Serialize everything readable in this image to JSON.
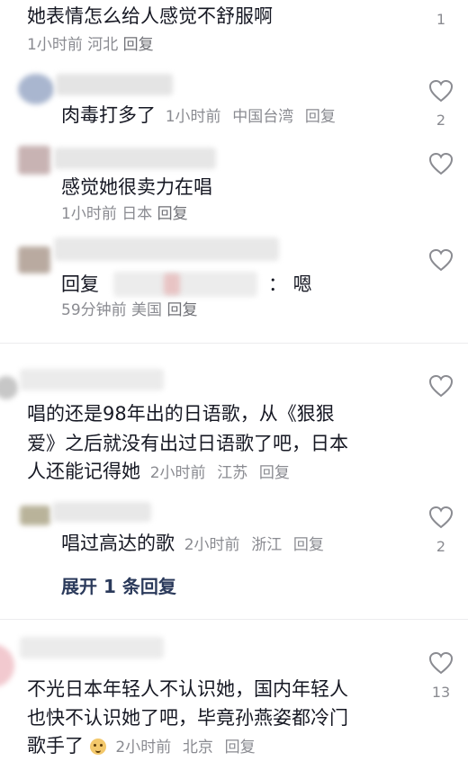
{
  "comments": [
    {
      "text": "她表情怎么给人感觉不舒服啊",
      "time": "1小时前",
      "location": "河北",
      "reply": "回复",
      "likes": "1"
    },
    {
      "text": "肉毒打多了",
      "time": "1小时前",
      "location": "中国台湾",
      "reply": "回复",
      "likes": "2"
    },
    {
      "text": "感觉她很卖力在唱",
      "time": "1小时前",
      "location": "日本",
      "reply": "回复",
      "likes": ""
    },
    {
      "reply_prefix": "回复",
      "text_suffix": "：  嗯",
      "time": "59分钟前",
      "location": "美国",
      "reply": "回复",
      "likes": ""
    },
    {
      "line1": "唱的还是98年出的日语歌，从《狠狠",
      "line2": "爱》之后就没有出过日语歌了吧，日本",
      "line3": "人还能记得她",
      "time": "2小时前",
      "location": "江苏",
      "reply": "回复",
      "likes": ""
    },
    {
      "text": "唱过高达的歌",
      "time": "2小时前",
      "location": "浙江",
      "reply": "回复",
      "likes": "2"
    },
    {
      "line1": "不光日本年轻人不认识她，国内年轻人",
      "line2": "也快不认识她了吧，毕竟孙燕姿都冷门",
      "line3": "歌手了",
      "time": "2小时前",
      "location": "北京",
      "reply": "回复",
      "likes": "13"
    }
  ],
  "expand_replies": "展开 1 条回复",
  "icons": {
    "like": "heart-outline-icon",
    "emoji": "doge-emoji-icon"
  }
}
